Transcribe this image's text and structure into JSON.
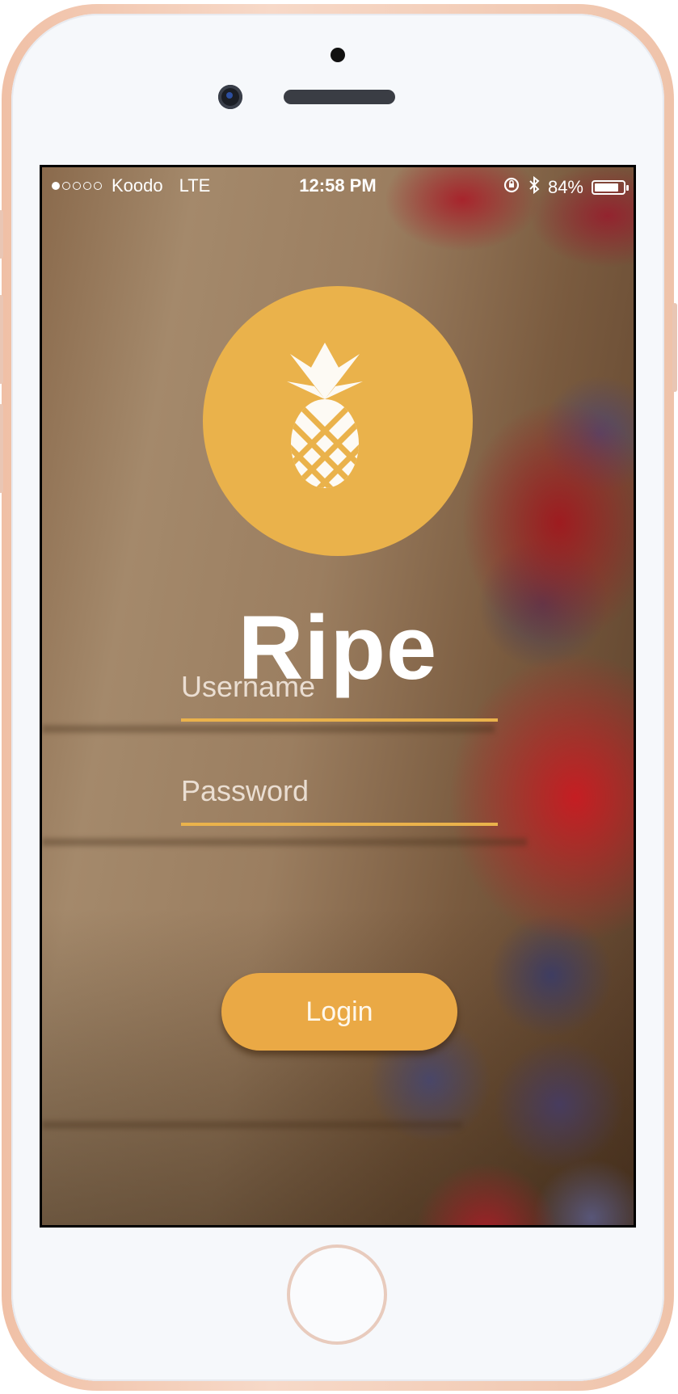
{
  "status_bar": {
    "signal_dots_filled": 1,
    "signal_dots_total": 5,
    "carrier": "Koodo",
    "network": "LTE",
    "time": "12:58 PM",
    "battery_percent": "84%",
    "battery_level": 0.84
  },
  "app": {
    "title": "Ripe",
    "logo_icon": "pineapple-icon",
    "accent_color": "#eab24b"
  },
  "form": {
    "username_placeholder": "Username",
    "password_placeholder": "Password",
    "login_label": "Login"
  }
}
